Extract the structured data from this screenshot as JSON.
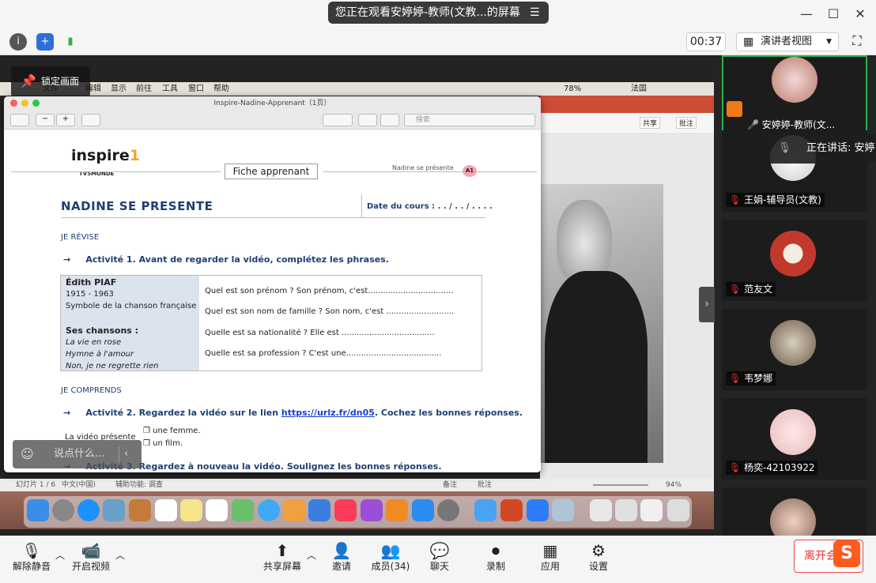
{
  "window": {
    "title": "您正在观看安婷婷-教师(文教...的屏幕"
  },
  "toolbar": {
    "timer": "00:37",
    "view_label": "演讲者视图"
  },
  "lock_tip": "锁定画面",
  "mac_menu": [
    "文件",
    "编辑",
    "显示",
    "前往",
    "工具",
    "窗口",
    "帮助"
  ],
  "mac_status": {
    "battery": "78%",
    "lang": "法国"
  },
  "ppt": {
    "share": "共享",
    "comment": "批注",
    "status_slide": "幻灯片 1 / 6",
    "status_lang": "中文(中国)",
    "status_access": "辅助功能: 调查",
    "status_notes": "备注",
    "status_comments": "批注",
    "zoom": "94%"
  },
  "preview": {
    "title": "Inspire-Nadine-Apprenant（1页）",
    "search_placeholder": "搜索",
    "doc": {
      "logo": "inspire",
      "logo_sub": "TV5MONDE",
      "fiche": "Fiche apprenant",
      "header_small": "Nadine se présente",
      "level": "A1",
      "h1": "NADINE SE PRESENTE",
      "date": "Date du cours : . . / . . / . . . .",
      "sec1": "JE RÉVISE",
      "act1": "Activité 1. Avant de regarder la vidéo, complétez les phrases.",
      "bio_name": "Édith PIAF",
      "bio_years": "1915 - 1963",
      "bio_desc": "Symbole de la chanson française",
      "songs_title": "Ses chansons :",
      "songs": [
        "La vie en rose",
        "Hymne à l'amour",
        "Non, je ne regrette rien"
      ],
      "questions": [
        "Quel est son prénom ? Son prénom, c'est..................................",
        "Quel est son nom de famille ? Son nom, c'est ...........................",
        "Quelle est sa nationalité ? Elle est .....................................",
        "Quelle est sa profession ? C'est une......................................"
      ],
      "sec2": "JE COMPRENDS",
      "act2_pre": "Activité 2. Regardez la vidéo sur le lien ",
      "act2_link": "https://urlz.fr/dn05",
      "act2_post": ". Cochez les bonnes réponses.",
      "video_q": "La vidéo présente",
      "opt1": "❒ une femme.",
      "opt2": "❒ un film.",
      "act3": "Activité 3. Regardez à nouveau la vidéo. Soulignez les bonnes réponses."
    }
  },
  "chat_placeholder": "说点什么...",
  "speaking": "正在讲话: 安婷",
  "participants": [
    {
      "name": "安婷婷-教师(文..."
    },
    {
      "name": "王娟-辅导员(文教)"
    },
    {
      "name": "范友文"
    },
    {
      "name": "韦梦娜"
    },
    {
      "name": "杨奕-42103922"
    }
  ],
  "bottom": {
    "mute": "解除静音",
    "video": "开启视频",
    "share": "共享屏幕",
    "invite": "邀请",
    "members": "成员(34)",
    "chat": "聊天",
    "record": "录制",
    "apps": "应用",
    "settings": "设置",
    "leave": "离开会议"
  }
}
